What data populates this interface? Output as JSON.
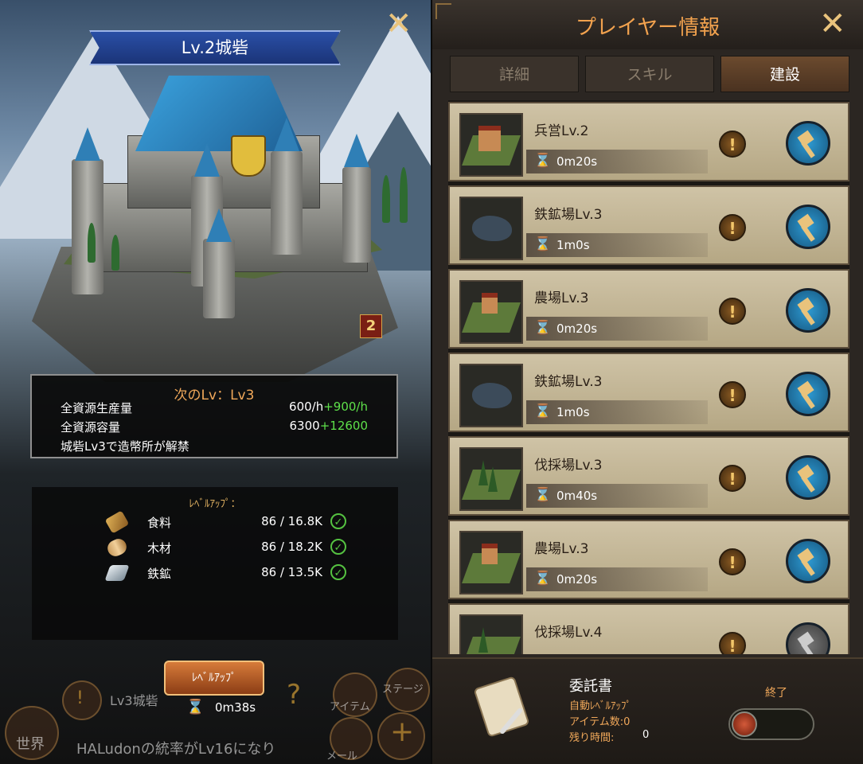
{
  "left_panel": {
    "title": "Lv.2城砦",
    "close_icon": "close-icon",
    "castle_level_badge": "2",
    "next_level": {
      "title": "次のLv：Lv3",
      "rows": [
        {
          "label": "全資源生産量",
          "value": "600/h",
          "bonus": "+900/h"
        },
        {
          "label": "全資源容量",
          "value": "6300",
          "bonus": "+12600"
        }
      ],
      "note": "城砦Lv3で造幣所が解禁"
    },
    "levelup_requirements": {
      "title": "ﾚﾍﾞﾙｱｯﾌﾟ：",
      "items": [
        {
          "icon": "food-icon",
          "label": "食料",
          "amount": "86 / 16.8K"
        },
        {
          "icon": "wood-icon",
          "label": "木材",
          "amount": "86 / 18.2K"
        },
        {
          "icon": "iron-icon",
          "label": "鉄鉱",
          "amount": "86 / 13.5K"
        }
      ]
    },
    "levelup_button": "ﾚﾍﾞﾙｱｯﾌﾟ",
    "timer": "0m38s",
    "background_text": {
      "quest": "Lv3城砦",
      "item": "アイテム",
      "stage": "ステージ",
      "world": "世界",
      "mail": "メール",
      "chat": "HALudonの統率がLv16になり"
    }
  },
  "right_panel": {
    "title": "プレイヤー情報",
    "tabs": [
      {
        "label": "詳細",
        "active": false
      },
      {
        "label": "スキル",
        "active": false
      },
      {
        "label": "建設",
        "active": true
      }
    ],
    "buildings": [
      {
        "name": "兵営Lv.2",
        "time": "0m20s",
        "type": "barracks",
        "buildable": true
      },
      {
        "name": "鉄鉱場Lv.3",
        "time": "1m0s",
        "type": "iron",
        "buildable": true
      },
      {
        "name": "農場Lv.3",
        "time": "0m20s",
        "type": "farm",
        "buildable": true
      },
      {
        "name": "鉄鉱場Lv.3",
        "time": "1m0s",
        "type": "iron",
        "buildable": true
      },
      {
        "name": "伐採場Lv.3",
        "time": "0m40s",
        "type": "lumber",
        "buildable": true
      },
      {
        "name": "農場Lv.3",
        "time": "0m20s",
        "type": "farm",
        "buildable": true
      },
      {
        "name": "伐採場Lv.4",
        "time": "",
        "type": "lumber",
        "buildable": false
      }
    ],
    "footer": {
      "title": "委託書",
      "auto_levelup": "自動ﾚﾍﾞﾙｱｯﾌﾟ",
      "item_count": "アイテム数:0",
      "remaining_label": "残り時間:",
      "remaining_value": "0",
      "end_label": "終了"
    }
  }
}
